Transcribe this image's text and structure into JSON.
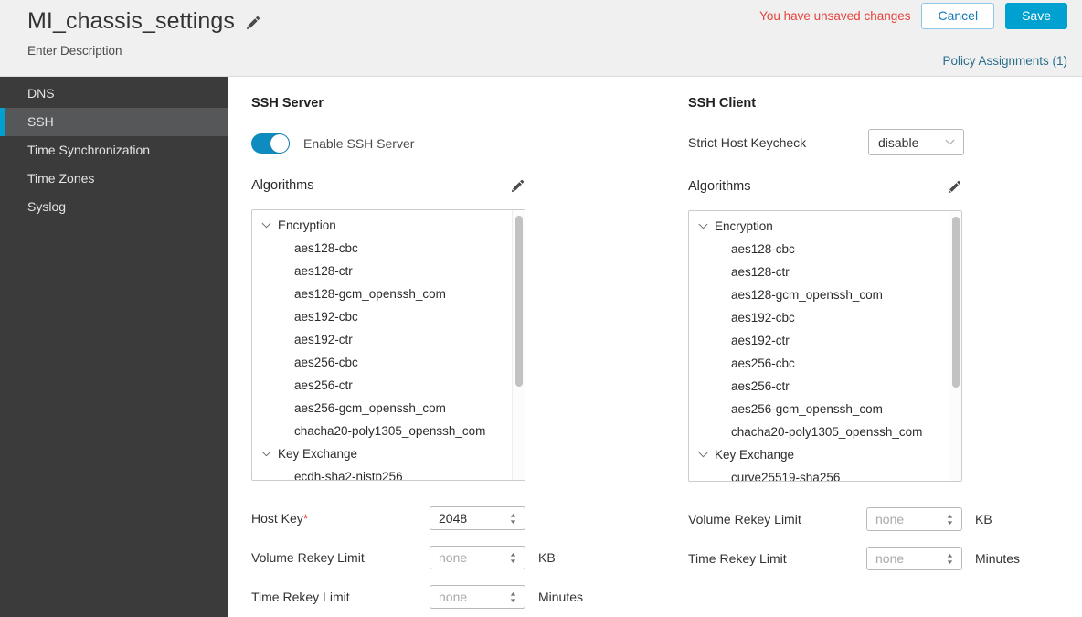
{
  "header": {
    "title": "MI_chassis_settings",
    "edit_icon": "pencil-icon",
    "description": "Enter Description",
    "unsaved_message": "You have unsaved changes",
    "cancel_label": "Cancel",
    "save_label": "Save",
    "policy_assignments": "Policy Assignments (1)",
    "accent_blue": "#00a0d1",
    "link_color": "#2a6e8e",
    "warning_color": "#e8403a"
  },
  "sidebar": {
    "background": "#3b3b3b",
    "selected_background": "#555759",
    "selected_accent": "#00a0d1",
    "items": [
      {
        "label": "DNS",
        "selected": false
      },
      {
        "label": "SSH",
        "selected": true
      },
      {
        "label": "Time Synchronization",
        "selected": false
      },
      {
        "label": "Time Zones",
        "selected": false
      },
      {
        "label": "Syslog",
        "selected": false
      }
    ]
  },
  "ssh_server": {
    "section_title": "SSH Server",
    "enable_toggle": {
      "label": "Enable SSH Server",
      "state": "on",
      "on_color": "#0e8bbf"
    },
    "algorithms": {
      "label": "Algorithms",
      "edit_icon": "pencil-icon",
      "groups": [
        {
          "name": "Encryption",
          "expanded": true,
          "items": [
            "aes128-cbc",
            "aes128-ctr",
            "aes128-gcm_openssh_com",
            "aes192-cbc",
            "aes192-ctr",
            "aes256-cbc",
            "aes256-ctr",
            "aes256-gcm_openssh_com",
            "chacha20-poly1305_openssh_com"
          ]
        },
        {
          "name": "Key Exchange",
          "expanded": true,
          "items": [
            "ecdh-sha2-nistp256"
          ]
        }
      ]
    },
    "fields": [
      {
        "label": "Host Key",
        "required": true,
        "value": "2048",
        "placeholder": "",
        "unit": ""
      },
      {
        "label": "Volume Rekey Limit",
        "required": false,
        "value": "",
        "placeholder": "none",
        "unit": "KB"
      },
      {
        "label": "Time Rekey Limit",
        "required": false,
        "value": "",
        "placeholder": "none",
        "unit": "Minutes"
      }
    ]
  },
  "ssh_client": {
    "section_title": "SSH Client",
    "strict_host_keycheck": {
      "label": "Strict Host Keycheck",
      "value": "disable",
      "icon": "chevron-down-icon"
    },
    "algorithms": {
      "label": "Algorithms",
      "edit_icon": "pencil-icon",
      "groups": [
        {
          "name": "Encryption",
          "expanded": true,
          "items": [
            "aes128-cbc",
            "aes128-ctr",
            "aes128-gcm_openssh_com",
            "aes192-cbc",
            "aes192-ctr",
            "aes256-cbc",
            "aes256-ctr",
            "aes256-gcm_openssh_com",
            "chacha20-poly1305_openssh_com"
          ]
        },
        {
          "name": "Key Exchange",
          "expanded": true,
          "items": [
            "curve25519-sha256"
          ]
        }
      ]
    },
    "fields": [
      {
        "label": "Volume Rekey Limit",
        "required": false,
        "value": "",
        "placeholder": "none",
        "unit": "KB"
      },
      {
        "label": "Time Rekey Limit",
        "required": false,
        "value": "",
        "placeholder": "none",
        "unit": "Minutes"
      }
    ]
  }
}
